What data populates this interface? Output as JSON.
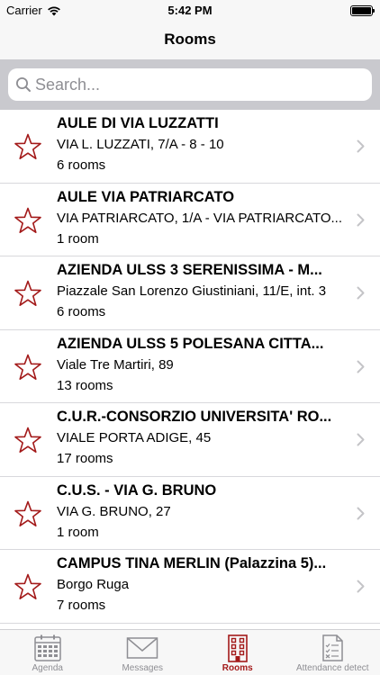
{
  "status_bar": {
    "carrier": "Carrier",
    "time": "5:42 PM"
  },
  "nav": {
    "title": "Rooms"
  },
  "search": {
    "placeholder": "Search..."
  },
  "colors": {
    "accent": "#a31a1a",
    "inactive": "#8e8e93"
  },
  "rooms": [
    {
      "title": "AULE DI VIA LUZZATTI",
      "address": "VIA L. LUZZATI, 7/A - 8 - 10",
      "count": "6 rooms"
    },
    {
      "title": "AULE VIA PATRIARCATO",
      "address": "VIA PATRIARCATO, 1/A - VIA PATRIARCATO...",
      "count": "1 room"
    },
    {
      "title": "AZIENDA ULSS 3 SERENISSIMA - M...",
      "address": "Piazzale San Lorenzo Giustiniani, 11/E, int. 3",
      "count": "6 rooms"
    },
    {
      "title": "AZIENDA ULSS 5 POLESANA CITTA...",
      "address": "Viale Tre Martiri, 89",
      "count": "13 rooms"
    },
    {
      "title": "C.U.R.-CONSORZIO UNIVERSITA' RO...",
      "address": "VIALE PORTA ADIGE, 45",
      "count": "17 rooms"
    },
    {
      "title": "C.U.S. - VIA G. BRUNO",
      "address": "VIA G. BRUNO, 27",
      "count": "1 room"
    },
    {
      "title": "CAMPUS TINA MERLIN (Palazzina 5)...",
      "address": "Borgo Ruga",
      "count": "7 rooms"
    }
  ],
  "tabs": [
    {
      "label": "Agenda",
      "icon": "calendar-icon"
    },
    {
      "label": "Messages",
      "icon": "envelope-icon"
    },
    {
      "label": "Rooms",
      "icon": "building-icon"
    },
    {
      "label": "Attendance detect",
      "icon": "attendance-sheet-icon"
    }
  ]
}
